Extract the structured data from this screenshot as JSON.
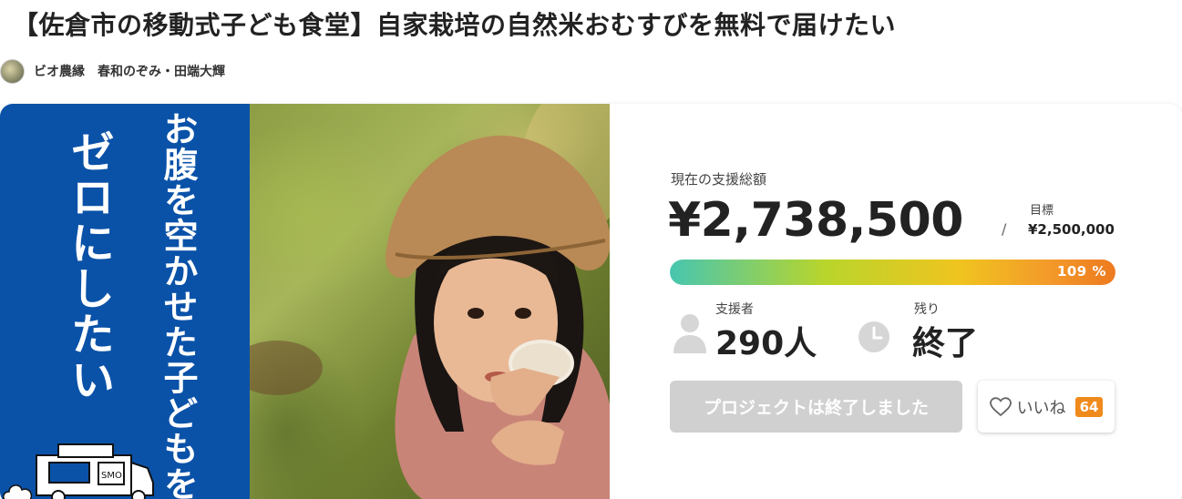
{
  "project": {
    "title": "【佐倉市の移動式子ども食堂】自家栽培の自然米おむすびを無料で届けたい",
    "owner": "ビオ農縁　春和のぞみ・田端大輝"
  },
  "visual": {
    "tagline_1": "お腹を空かせた子どもを",
    "tagline_2": "ゼロにしたい",
    "truck_sign": "SMO"
  },
  "stats": {
    "amount_label": "現在の支援総額",
    "amount": "¥2,738,500",
    "slash": "/",
    "goal_label": "目標",
    "goal": "¥2,500,000",
    "progress_text": "109 %",
    "progress_percent": 109,
    "supporters_label": "支援者",
    "supporters": "290人",
    "remaining_label": "残り",
    "remaining": "終了"
  },
  "actions": {
    "ended_label": "プロジェクトは終了しました",
    "like_label": "いいね",
    "like_count": "64"
  },
  "colors": {
    "panel_blue": "#0a52a8",
    "like_badge": "#f08a1c",
    "button_disabled": "#d0d0d0"
  }
}
